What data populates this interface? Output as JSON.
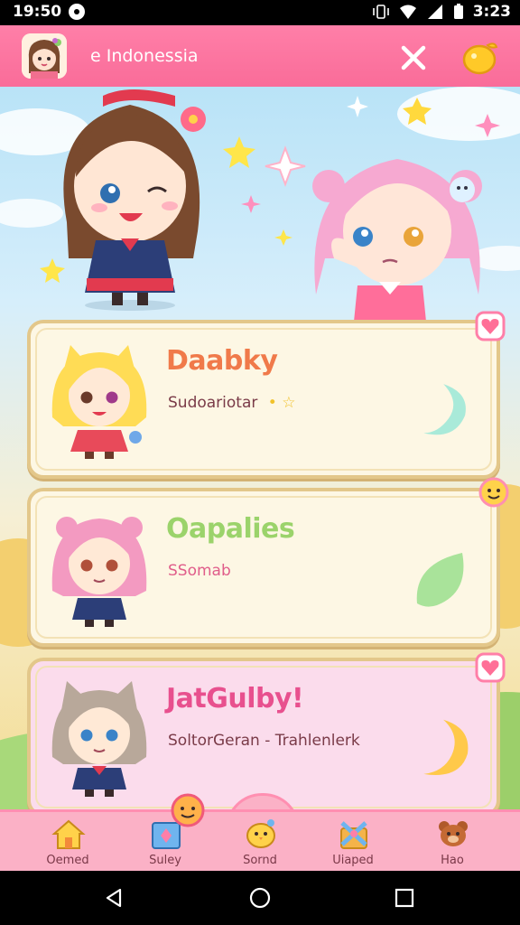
{
  "status_bar": {
    "time": "19:50",
    "clock_right": "3:23",
    "icons": [
      "notification-dot-icon",
      "vibrate-icon",
      "wifi-icon",
      "signal-icon",
      "battery-icon"
    ]
  },
  "app_bar": {
    "title": "e Indonessia",
    "close_icon": "close-icon",
    "action_icon": "lemon-icon"
  },
  "cards": [
    {
      "name": "Daabky",
      "subtitle": "Sudoariotar",
      "subtitle_suffix": "• ☆",
      "name_color": "#f07a4a",
      "bg": "#fdf7e4",
      "badge": "heart-icon",
      "deco": "mint-moon-icon"
    },
    {
      "name": "Oapalies",
      "subtitle": "SSomab",
      "name_color": "#9bd36b",
      "bg": "#fdf7e4",
      "badge": "smile-face-icon",
      "deco": "green-leaf-icon"
    },
    {
      "name": "JatGulby!",
      "subtitle": "SoltorGeran - Trahlenlerk",
      "name_color": "#e8508e",
      "bg": "#fbdcec",
      "badge": "heart-icon",
      "deco": "yellow-moon-icon"
    }
  ],
  "bottom_nav": [
    {
      "label": "Oemed",
      "icon": "house-icon"
    },
    {
      "label": "Suley",
      "icon": "photo-frame-icon"
    },
    {
      "label": "Sornd",
      "icon": "chick-icon"
    },
    {
      "label": "Uiaped",
      "icon": "gift-box-icon"
    },
    {
      "label": "Hao",
      "icon": "bear-icon"
    }
  ],
  "system_nav": [
    "back-icon",
    "home-icon",
    "recents-icon"
  ]
}
